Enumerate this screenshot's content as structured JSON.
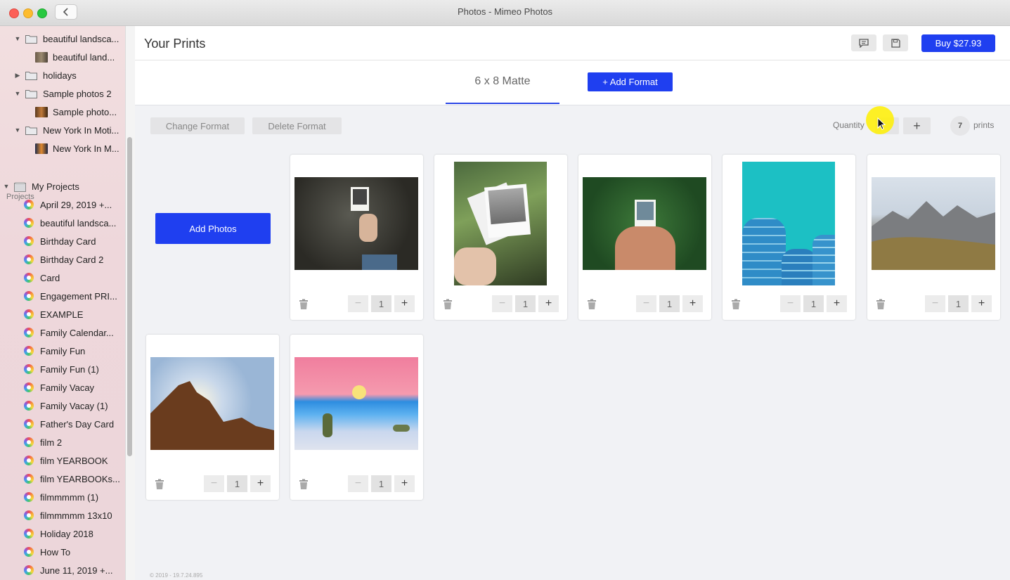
{
  "window": {
    "title": "Photos - Mimeo Photos"
  },
  "sidebar": {
    "albums": [
      {
        "label": "beautiful landsca...",
        "type": "folder",
        "expanded": true
      },
      {
        "label": "beautiful land...",
        "type": "photo"
      },
      {
        "label": "holidays",
        "type": "folder",
        "expanded": false
      },
      {
        "label": "Sample photos 2",
        "type": "folder",
        "expanded": true
      },
      {
        "label": "Sample photo...",
        "type": "photo"
      },
      {
        "label": "New York In Moti...",
        "type": "folder",
        "expanded": true
      },
      {
        "label": "New York In M...",
        "type": "photo"
      }
    ],
    "projects_heading": "Projects",
    "projects_root": "My Projects",
    "projects": [
      "April 29, 2019 +...",
      "beautiful landsca...",
      "Birthday Card",
      "Birthday Card 2",
      "Card",
      "Engagement PRI...",
      "EXAMPLE",
      "Family Calendar...",
      "Family Fun",
      "Family Fun (1)",
      "Family Vacay",
      "Family Vacay (1)",
      "Father's Day Card",
      "film 2",
      "film YEARBOOK",
      "film YEARBOOKs...",
      "filmmmmm (1)",
      "filmmmmm 13x10",
      "Holiday 2018",
      "How To",
      "June 11, 2019 +..."
    ]
  },
  "header": {
    "title": "Your Prints",
    "chat_icon": "chat-bubble-icon",
    "save_icon": "floppy-disk-icon",
    "buy_label": "Buy $27.93"
  },
  "tabs": {
    "active_format": "6 x 8 Matte",
    "add_format_label": "+ Add Format"
  },
  "toolbar": {
    "change_format": "Change Format",
    "delete_format": "Delete Format",
    "quantity_label": "Quantity",
    "plus": "+",
    "count": "7",
    "prints_label": "prints"
  },
  "add_photos_label": "Add Photos",
  "prints": [
    {
      "qty": "1",
      "minus": "−",
      "plus": "+"
    },
    {
      "qty": "1",
      "minus": "−",
      "plus": "+"
    },
    {
      "qty": "1",
      "minus": "−",
      "plus": "+"
    },
    {
      "qty": "1",
      "minus": "−",
      "plus": "+"
    },
    {
      "qty": "1",
      "minus": "−",
      "plus": "+"
    },
    {
      "qty": "1",
      "minus": "−",
      "plus": "+"
    },
    {
      "qty": "1",
      "minus": "−",
      "plus": "+"
    }
  ],
  "footer": {
    "version": "© 2019 - 19.7.24.895"
  },
  "colors": {
    "accent": "#1f3ff0",
    "tab_underline": "#2b47e6"
  }
}
